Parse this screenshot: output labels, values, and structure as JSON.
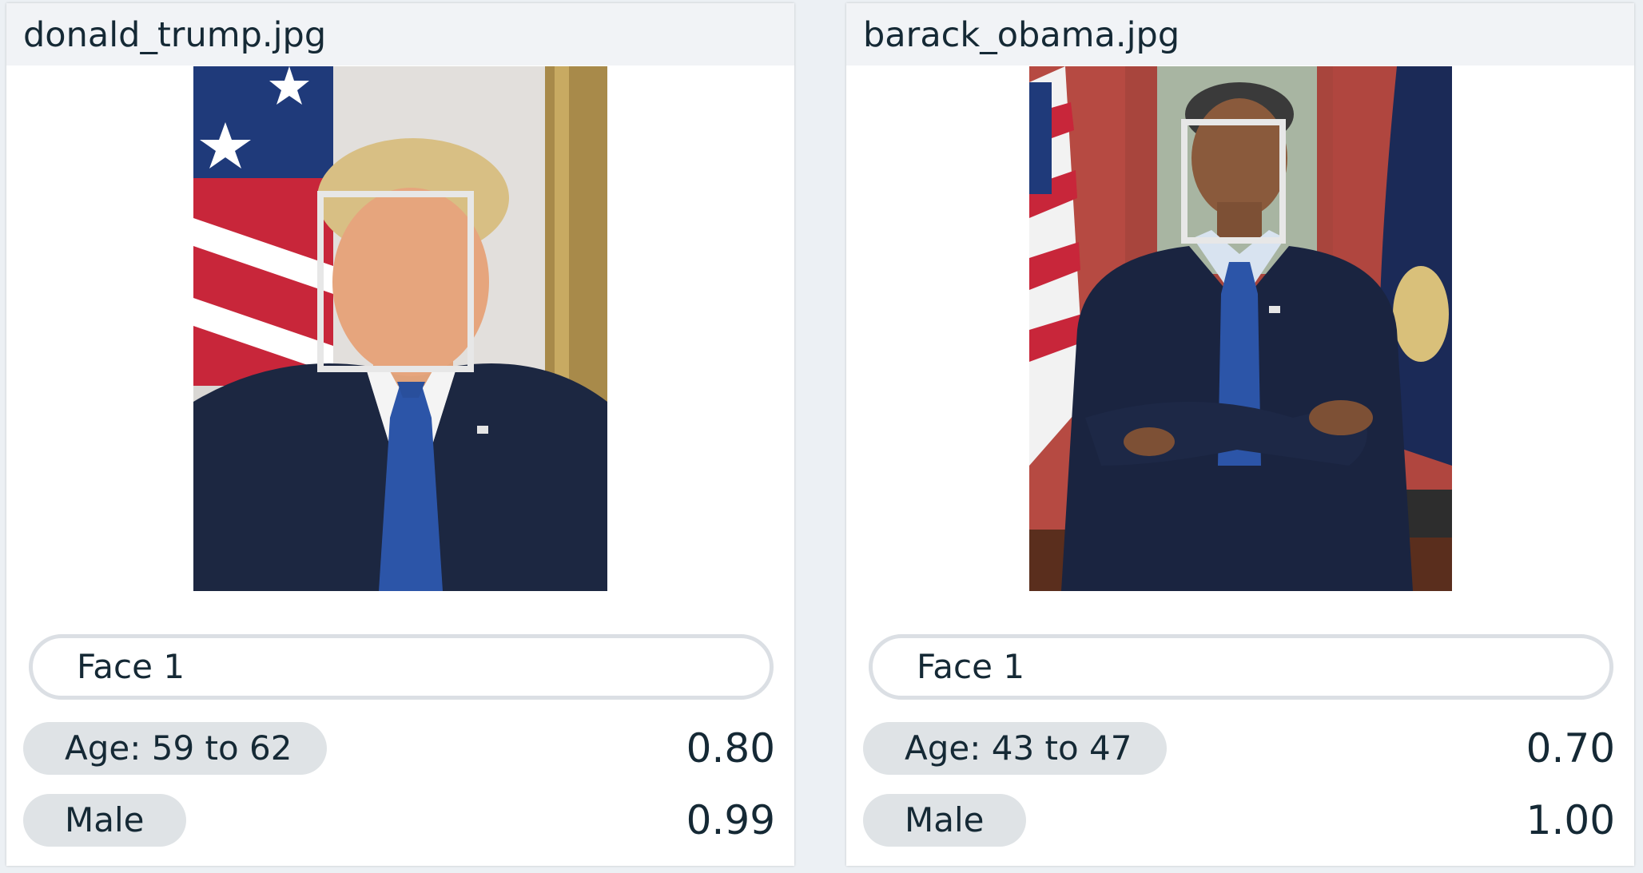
{
  "cards": [
    {
      "filename": "donald_trump.jpg",
      "face_select": "Face 1",
      "age": {
        "label": "Age: 59 to 62",
        "score": "0.80"
      },
      "gender": {
        "label": "Male",
        "score": "0.99"
      }
    },
    {
      "filename": "barack_obama.jpg",
      "face_select": "Face 1",
      "age": {
        "label": "Age: 43 to 47",
        "score": "0.70"
      },
      "gender": {
        "label": "Male",
        "score": "1.00"
      }
    }
  ],
  "colors": {
    "page_background": "#ecf0f4",
    "card_header": "#f1f3f6",
    "tag_background": "#dfe3e6",
    "face_box": "#e7e7e7",
    "text": "#152935"
  }
}
